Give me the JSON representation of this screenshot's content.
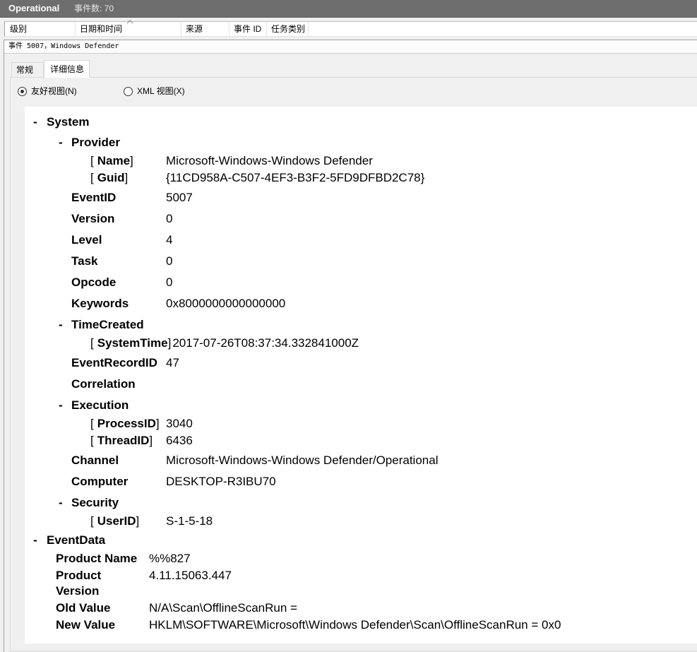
{
  "window": {
    "title": "Operational",
    "event_count": "事件数: 70"
  },
  "event_list": {
    "columns": [
      {
        "label": "级别"
      },
      {
        "label": "日期和时间",
        "sort_icon": "sort-ascending-icon"
      },
      {
        "label": "来源"
      },
      {
        "label": "事件 ID"
      },
      {
        "label": "任务类别"
      }
    ]
  },
  "preview": {
    "title": "事件 5007，Windows Defender",
    "tabs": [
      {
        "label": "常规",
        "active": false
      },
      {
        "label": "详细信息",
        "active": true
      }
    ],
    "view_modes": [
      {
        "label": "友好视图(N)",
        "selected": true
      },
      {
        "label": "XML 视图(X)",
        "selected": false
      }
    ]
  },
  "details": {
    "collapse_glyph": "-",
    "bracket_open": "[",
    "bracket_close": "]",
    "system": {
      "label": "System",
      "provider": {
        "label": "Provider",
        "attributes": [
          {
            "name": "Name",
            "value": "Microsoft-Windows-Windows Defender"
          },
          {
            "name": "Guid",
            "value": "{11CD958A-C507-4EF3-B3F2-5FD9DFBD2C78}"
          }
        ]
      },
      "event_id": {
        "label": "EventID",
        "value": "5007"
      },
      "version": {
        "label": "Version",
        "value": "0"
      },
      "level": {
        "label": "Level",
        "value": "4"
      },
      "task": {
        "label": "Task",
        "value": "0"
      },
      "opcode": {
        "label": "Opcode",
        "value": "0"
      },
      "keywords": {
        "label": "Keywords",
        "value": "0x8000000000000000"
      },
      "time_created": {
        "label": "TimeCreated",
        "attributes": [
          {
            "name": "SystemTime",
            "value": "2017-07-26T08:37:34.332841000Z"
          }
        ]
      },
      "event_record_id": {
        "label": "EventRecordID",
        "value": "47"
      },
      "correlation": {
        "label": "Correlation"
      },
      "execution": {
        "label": "Execution",
        "attributes": [
          {
            "name": "ProcessID",
            "value": "3040"
          },
          {
            "name": "ThreadID",
            "value": "6436"
          }
        ]
      },
      "channel": {
        "label": "Channel",
        "value": "Microsoft-Windows-Windows Defender/Operational"
      },
      "computer": {
        "label": "Computer",
        "value": "DESKTOP-R3IBU70"
      },
      "security": {
        "label": "Security",
        "attributes": [
          {
            "name": "UserID",
            "value": "S-1-5-18"
          }
        ]
      }
    },
    "event_data": {
      "label": "EventData",
      "items": [
        {
          "name": "Product Name",
          "value": "%%827"
        },
        {
          "name": "Product Version",
          "value": "4.11.15063.447"
        },
        {
          "name": "Old Value",
          "value": "N/A\\Scan\\OfflineScanRun ="
        },
        {
          "name": "New Value",
          "value": "HKLM\\SOFTWARE\\Microsoft\\Windows Defender\\Scan\\OfflineScanRun = 0x0"
        }
      ]
    }
  }
}
